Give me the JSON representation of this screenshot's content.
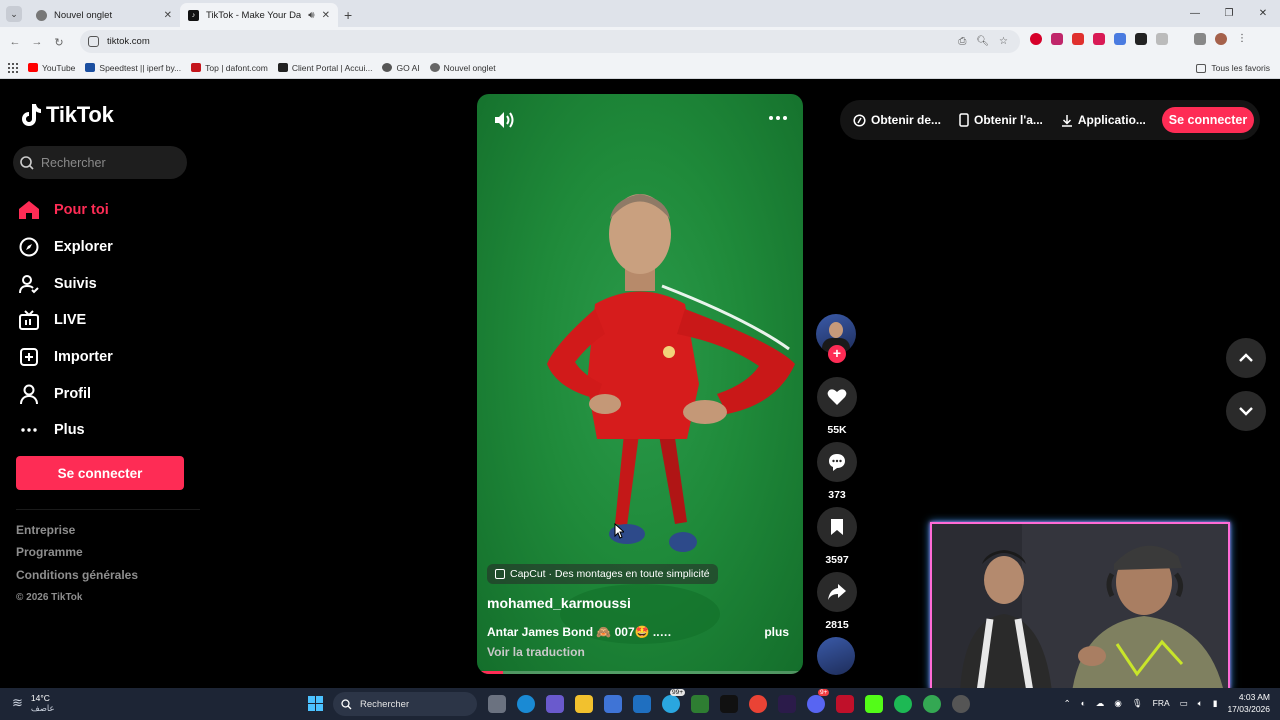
{
  "browser": {
    "tabs": [
      {
        "title": "Nouvel onglet",
        "active": false
      },
      {
        "title": "TikTok - Make Your Day",
        "active": true
      }
    ],
    "url": "tiktok.com",
    "bookmarks": [
      "YouTube",
      "Speedtest || iperf by...",
      "Top | dafont.com",
      "Client Portal | Accui...",
      "GO AI",
      "Nouvel onglet"
    ],
    "all_bookmarks": "Tous les favoris"
  },
  "tiktok": {
    "logo": "TikTok",
    "search_placeholder": "Rechercher",
    "nav": [
      {
        "label": "Pour toi",
        "icon": "home-icon",
        "active": true
      },
      {
        "label": "Explorer",
        "icon": "compass-icon",
        "active": false
      },
      {
        "label": "Suivis",
        "icon": "following-icon",
        "active": false
      },
      {
        "label": "LIVE",
        "icon": "live-tv-icon",
        "active": false
      },
      {
        "label": "Importer",
        "icon": "upload-plus-icon",
        "active": false
      },
      {
        "label": "Profil",
        "icon": "profile-icon",
        "active": false
      },
      {
        "label": "Plus",
        "icon": "more-dots-icon",
        "active": false
      }
    ],
    "login_button": "Se connecter",
    "footer": [
      "Entreprise",
      "Programme",
      "Conditions générales"
    ],
    "copyright": "© 2026 TikTok",
    "top_links": [
      "Obtenir de...",
      "Obtenir l'a...",
      "Applicatio..."
    ],
    "top_login": "Se connecter",
    "accent": "#fe2c55"
  },
  "video": {
    "capcut_tag": "CapCut · Des montages en toute simplicité",
    "author": "mohamed_karmoussi",
    "caption": "Antar James Bond 🙈 007🤩 ..…",
    "more_label": "plus",
    "translate_label": "Voir la traduction",
    "progress": 0.08,
    "likes": "55K",
    "comments": "373",
    "saves": "3597",
    "shares": "2815"
  },
  "taskbar": {
    "temperature": "14°C",
    "weather_text": "عاصف",
    "search": "Rechercher",
    "lang": "FRA",
    "time": "4:03 AM",
    "date": "17/03/2026",
    "badges": [
      "99+",
      "9+"
    ]
  }
}
